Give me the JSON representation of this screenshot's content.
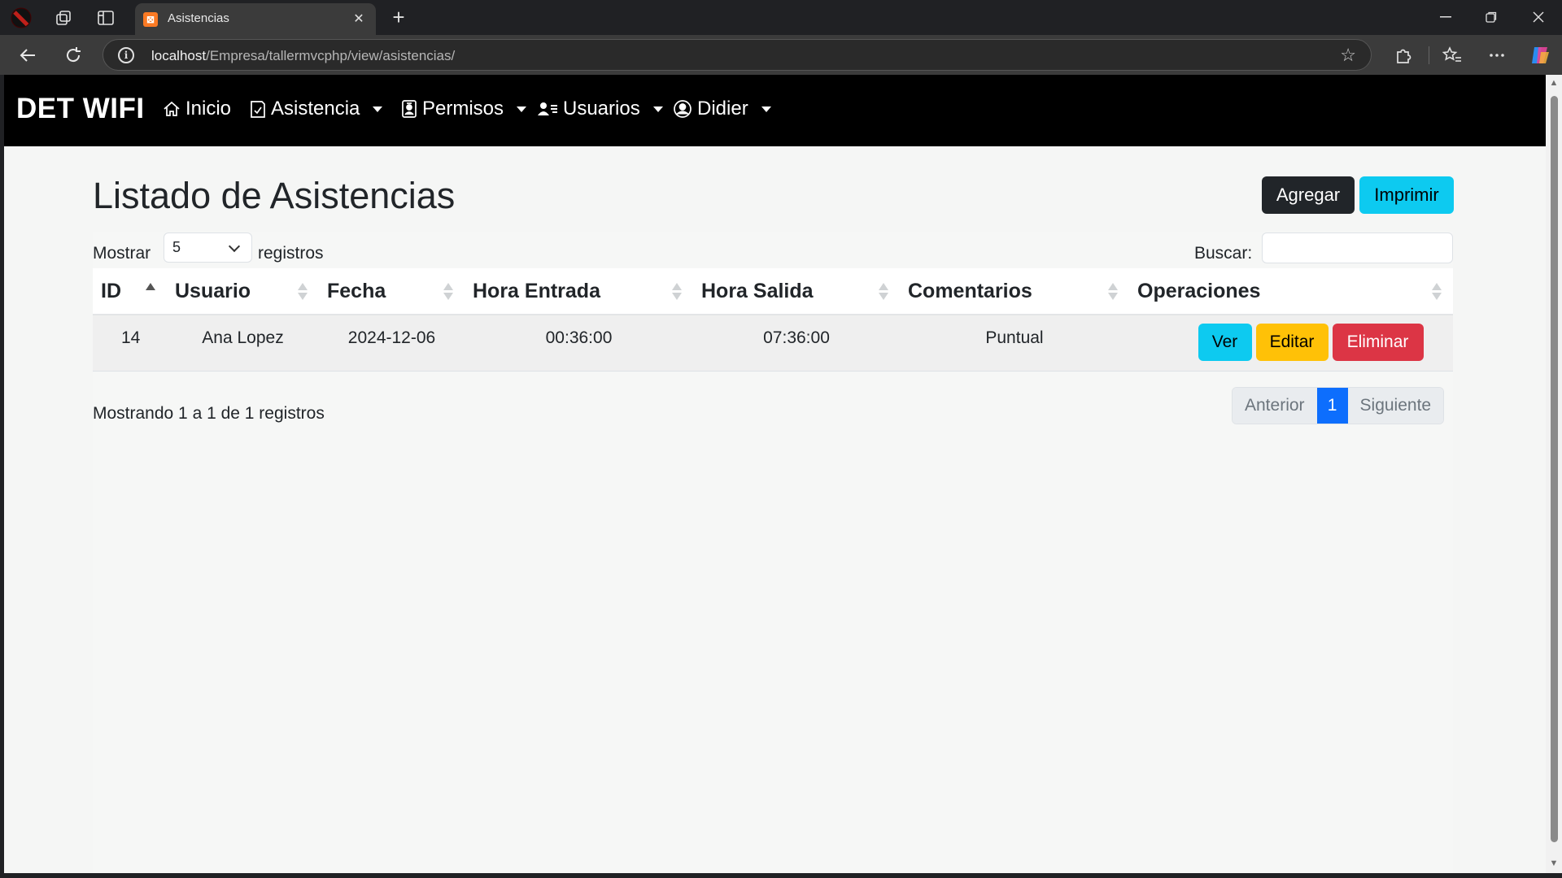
{
  "browser": {
    "tab_title": "Asistencias",
    "tab_favicon_letter": "⊠",
    "url_host": "localhost",
    "url_path": "/Empresa/tallermvcphp/view/asistencias/"
  },
  "navbar": {
    "brand": "DET WIFI",
    "items": [
      {
        "label": "Inicio",
        "icon": "house-icon",
        "dropdown": false
      },
      {
        "label": "Asistencia",
        "icon": "clipboard-check-icon",
        "dropdown": true
      },
      {
        "label": "Permisos",
        "icon": "badge-icon",
        "dropdown": true
      },
      {
        "label": "Usuarios",
        "icon": "people-icon",
        "dropdown": true
      },
      {
        "label": "Didier",
        "icon": "person-circle-icon",
        "dropdown": true
      }
    ]
  },
  "page": {
    "title": "Listado de Asistencias",
    "add_label": "Agregar",
    "print_label": "Imprimir"
  },
  "datatable": {
    "length_prefix": "Mostrar",
    "length_value": "5",
    "length_suffix": "registros",
    "search_label": "Buscar:",
    "search_value": "",
    "columns": [
      "ID",
      "Usuario",
      "Fecha",
      "Hora Entrada",
      "Hora Salida",
      "Comentarios",
      "Operaciones"
    ],
    "sorted_column": "ID",
    "rows": [
      {
        "id": "14",
        "usuario": "Ana Lopez",
        "fecha": "2024-12-06",
        "hora_entrada": "00:36:00",
        "hora_salida": "07:36:00",
        "comentarios": "Puntual",
        "ops": {
          "ver": "Ver",
          "editar": "Editar",
          "eliminar": "Eliminar"
        }
      }
    ],
    "info": "Mostrando 1 a 1 de 1 registros",
    "pagination": {
      "prev": "Anterior",
      "current": "1",
      "next": "Siguiente"
    }
  },
  "colors": {
    "navbar_bg": "#000000",
    "btn_dark": "#212529",
    "btn_info": "#0dcaf0",
    "btn_warning": "#ffc107",
    "btn_danger": "#dc3545",
    "page_active": "#0d6efd"
  }
}
